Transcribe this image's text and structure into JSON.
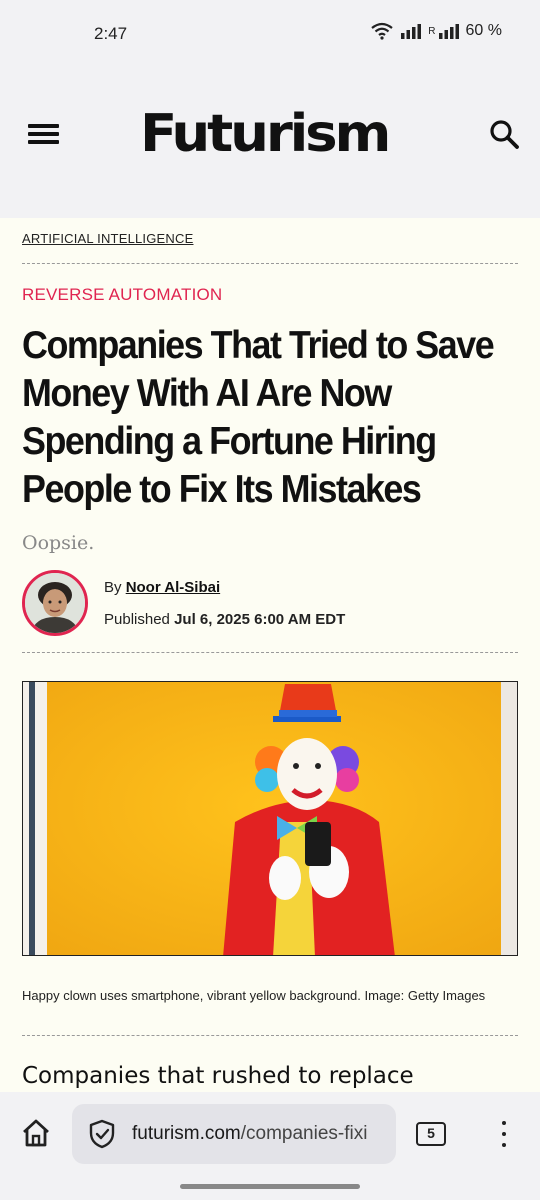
{
  "status_bar": {
    "time": "2:47",
    "battery": "60 %",
    "signal_roaming_label": "R"
  },
  "header": {
    "logo": "Futurism",
    "menu_icon": "hamburger-menu-icon",
    "search_icon": "search-icon"
  },
  "article": {
    "category": "ARTIFICIAL INTELLIGENCE",
    "kicker": "REVERSE AUTOMATION",
    "headline_lines": [
      "Companies That Tried to Save",
      "Money With AI Are Now",
      "Spending a Fortune Hiring",
      "People to Fix Its Mistakes"
    ],
    "dek": "Oopsie.",
    "byline_prefix": "By",
    "author": "Noor Al-Sibai",
    "published_prefix": "Published",
    "published_date": "Jul 6, 2025 6:00 AM EDT",
    "image_caption": "Happy clown uses smartphone, vibrant yellow background. Image: Getty Images",
    "body_start": "Companies that rushed to replace"
  },
  "browser": {
    "url_domain": "futurism.com",
    "url_path": "/companies-fixi",
    "tab_count": "5"
  },
  "colors": {
    "accent": "#e02550",
    "page_bg": "#fdfdf3",
    "chrome_bg": "#f2f2f4"
  }
}
